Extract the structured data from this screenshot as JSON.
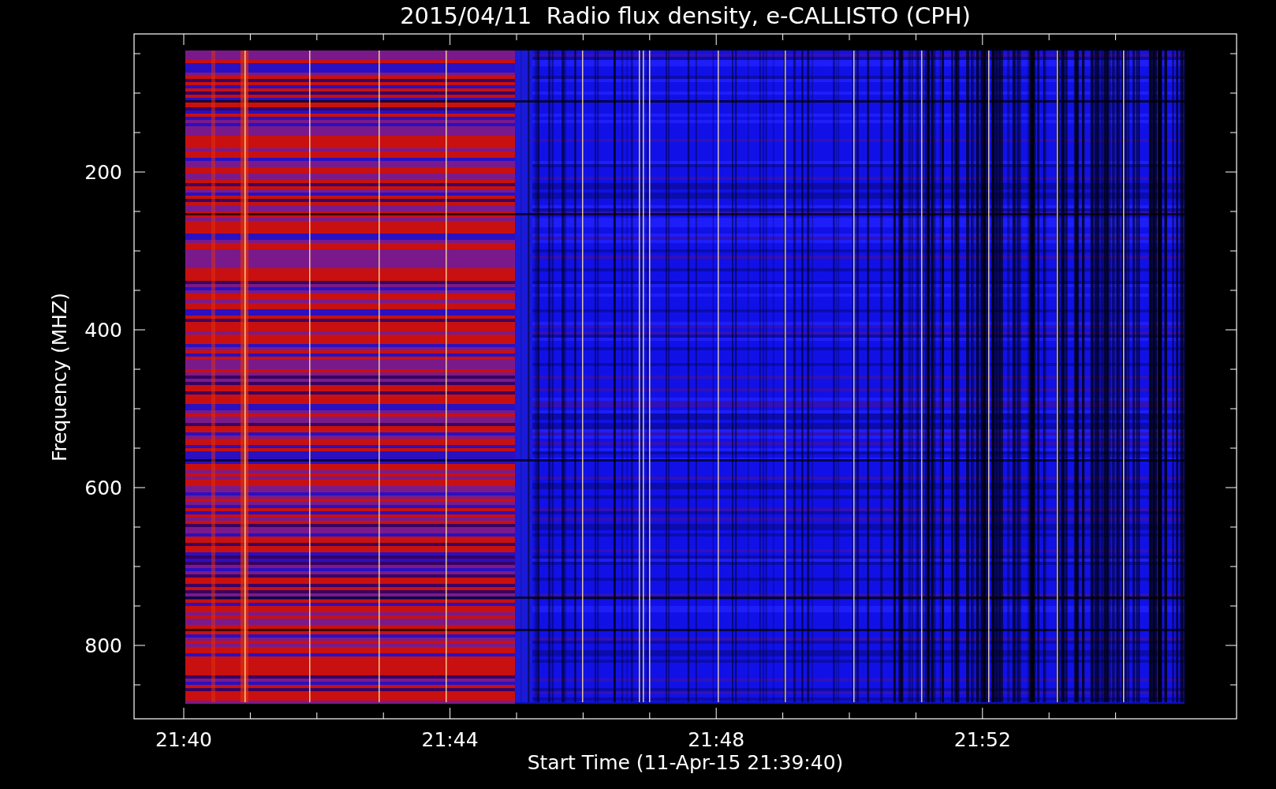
{
  "title": "2015/04/11  Radio flux density, e-CALLISTO (CPH)",
  "y_axis": {
    "label": "Frequency (MHZ)",
    "ticks": [
      "200",
      "400",
      "600",
      "800"
    ]
  },
  "x_axis": {
    "label": "Start Time (11-Apr-15 21:39:40)",
    "ticks": [
      "21:40",
      "21:44",
      "21:48",
      "21:52"
    ]
  }
}
